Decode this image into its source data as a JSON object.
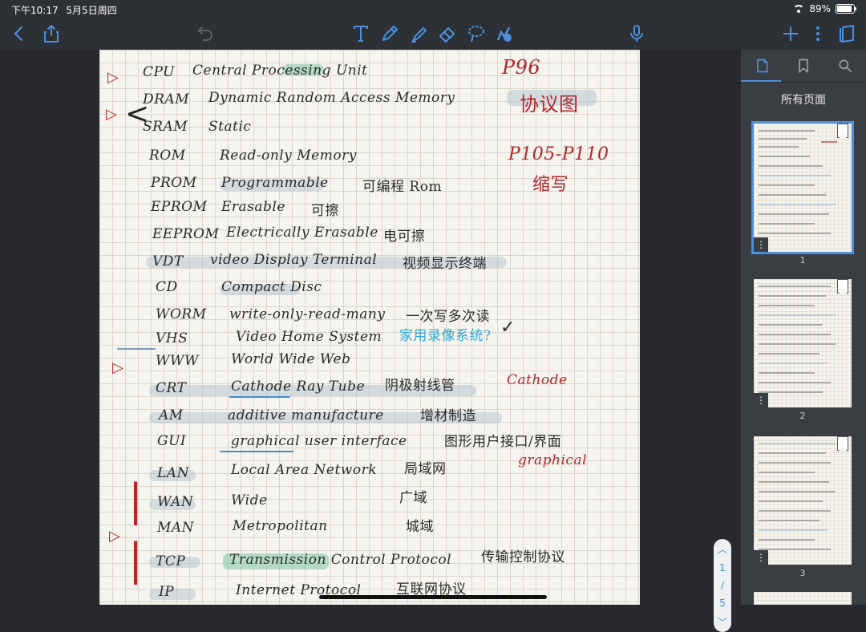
{
  "status_bar": {
    "time": "下午10:17",
    "date": "5月5日周四",
    "battery": "89%"
  },
  "toolbar": {
    "icons": [
      "back-icon",
      "share-icon",
      "undo-icon",
      "text-tool-icon",
      "pen-icon",
      "highlighter-icon",
      "eraser-icon",
      "lasso-icon",
      "shapes-icon",
      "microphone-icon",
      "add-icon",
      "more-icon",
      "pages-icon"
    ],
    "accent": "#4a90e2"
  },
  "notes": {
    "rows": [
      {
        "abbr": "CPU",
        "full": "Central Processing Unit",
        "note": ""
      },
      {
        "abbr": "DRAM",
        "full": "Dynamic Random Access Memory",
        "note": ""
      },
      {
        "abbr": "SRAM",
        "full": "Static",
        "note": ""
      },
      {
        "abbr": "ROM",
        "full": "Read-only Memory",
        "note": ""
      },
      {
        "abbr": "PROM",
        "full": "Programmable",
        "note": "可编程 Rom"
      },
      {
        "abbr": "EPROM",
        "full": "Erasable",
        "note": "可擦"
      },
      {
        "abbr": "EEPROM",
        "full": "Electrically Erasable",
        "note": "电可擦"
      },
      {
        "abbr": "VDT",
        "full": "video Display Terminal",
        "note": "视频显示终端"
      },
      {
        "abbr": "CD",
        "full": "Compact Disc",
        "note": ""
      },
      {
        "abbr": "WORM",
        "full": "write-only-read-many",
        "note": "一次写多次读"
      },
      {
        "abbr": "VHS",
        "full": "Video Home System",
        "note": "家用录像系统?"
      },
      {
        "abbr": "WWW",
        "full": "World Wide Web",
        "note": ""
      },
      {
        "abbr": "CRT",
        "full": "Cathode Ray Tube",
        "note": "阴极射线管"
      },
      {
        "abbr": "AM",
        "full": "additive manufacture",
        "note": "增材制造"
      },
      {
        "abbr": "GUI",
        "full": "graphical user interface",
        "note": "图形用户接口/界面"
      },
      {
        "abbr": "LAN",
        "full": "Local Area Network",
        "note": "局域网"
      },
      {
        "abbr": "WAN",
        "full": "Wide",
        "note": "广域"
      },
      {
        "abbr": "MAN",
        "full": "Metropolitan",
        "note": "城域"
      },
      {
        "abbr": "TCP",
        "full": "Transmission Control Protocol",
        "note": "传输控制协议"
      },
      {
        "abbr": "IP",
        "full": "Internet Protocol",
        "note": "互联网协议"
      }
    ],
    "margin_notes": {
      "p96": "P96",
      "protocol_diagram": "协议图",
      "p105": "P105-P110",
      "abbrev": "缩写",
      "cathode": "Cathode",
      "graphical": "graphical"
    }
  },
  "scroller": {
    "current": "1",
    "separator": "/",
    "total": "5"
  },
  "sidebar": {
    "title": "所有页面",
    "tabs": [
      "pages-tab-icon",
      "bookmark-tab-icon",
      "search-tab-icon"
    ],
    "thumbnails": [
      {
        "number": "1",
        "selected": true
      },
      {
        "number": "2",
        "selected": false
      },
      {
        "number": "3",
        "selected": false
      }
    ]
  }
}
